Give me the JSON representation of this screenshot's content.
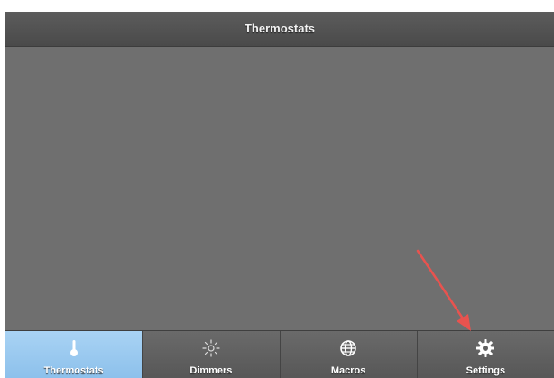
{
  "header": {
    "title": "Thermostats"
  },
  "tabs": [
    {
      "label": "Thermostats",
      "icon": "thermometer-icon",
      "active": true
    },
    {
      "label": "Dimmers",
      "icon": "light-bulb-icon",
      "active": false
    },
    {
      "label": "Macros",
      "icon": "globe-icon",
      "active": false
    },
    {
      "label": "Settings",
      "icon": "gear-icon",
      "active": false
    }
  ],
  "colors": {
    "active_tab": "#9fcbf0",
    "content_bg": "#6f6f6f",
    "annotation_arrow": "#e8534f"
  }
}
